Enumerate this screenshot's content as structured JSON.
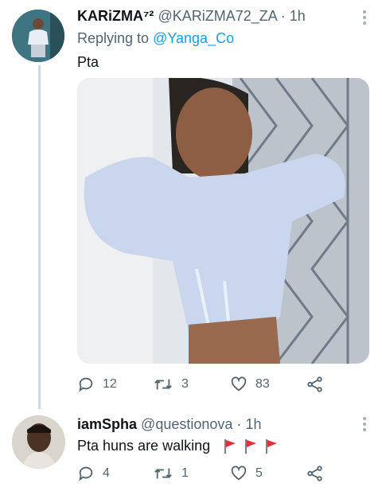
{
  "tweet1": {
    "name": "KARiZMA⁷²",
    "handle": "@KARiZMA72_ZA",
    "dot": "·",
    "time": "1h",
    "reply_prefix": "Replying to",
    "reply_mention": "@Yanga_Co",
    "text": "Pta",
    "stats": {
      "replies": "12",
      "retweets": "3",
      "likes": "83"
    }
  },
  "tweet2": {
    "name": "iamSpha",
    "handle": "@questionova",
    "dot": "·",
    "time": "1h",
    "text": "Pta huns are walking",
    "flags": [
      "triangular-flag",
      "triangular-flag",
      "triangular-flag"
    ],
    "stats": {
      "replies": "4",
      "retweets": "1",
      "likes": "5"
    }
  },
  "colors": {
    "link": "#1d9bf0",
    "secondary": "#536471",
    "thread_line": "#cfd9de",
    "flag": "#e0303b"
  },
  "icons": [
    "reply-icon",
    "retweet-icon",
    "like-icon",
    "share-icon",
    "more-icon"
  ]
}
